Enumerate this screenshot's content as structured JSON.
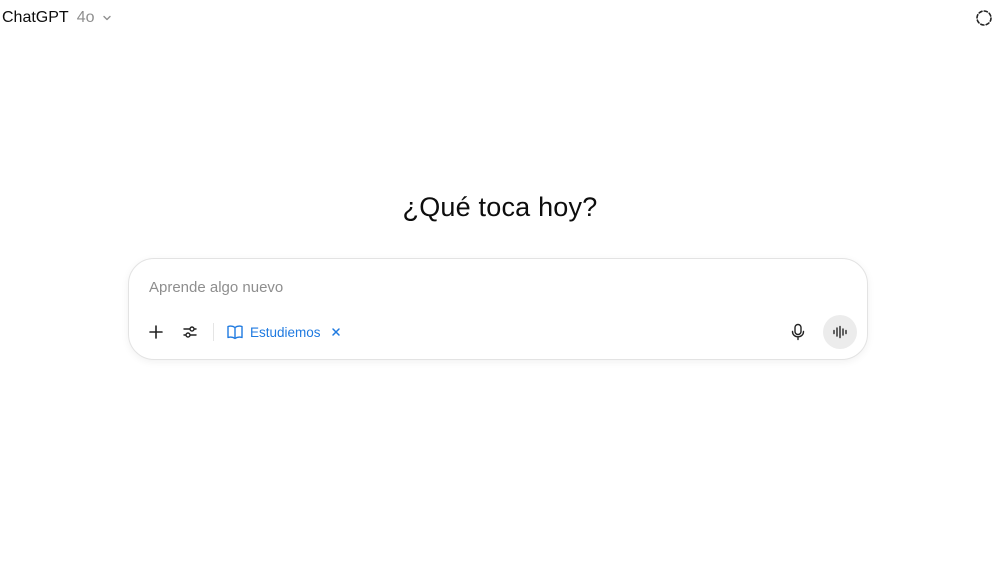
{
  "header": {
    "model_name": "ChatGPT",
    "model_version": "4o",
    "model_switcher_icon": "chevron-down-icon",
    "temporary_chat_icon": "dashed-circle-icon"
  },
  "main": {
    "heading": "¿Qué toca hoy?"
  },
  "composer": {
    "placeholder": "Aprende algo nuevo",
    "value": "",
    "tools": {
      "add_icon": "plus-icon",
      "tools_icon": "sliders-icon"
    },
    "active_tool": {
      "label": "Estudiemos",
      "icon": "open-book-icon",
      "close_icon": "close-icon",
      "color": "#1f7ae0"
    },
    "mic_icon": "microphone-icon",
    "voice_icon": "voice-waveform-icon"
  }
}
